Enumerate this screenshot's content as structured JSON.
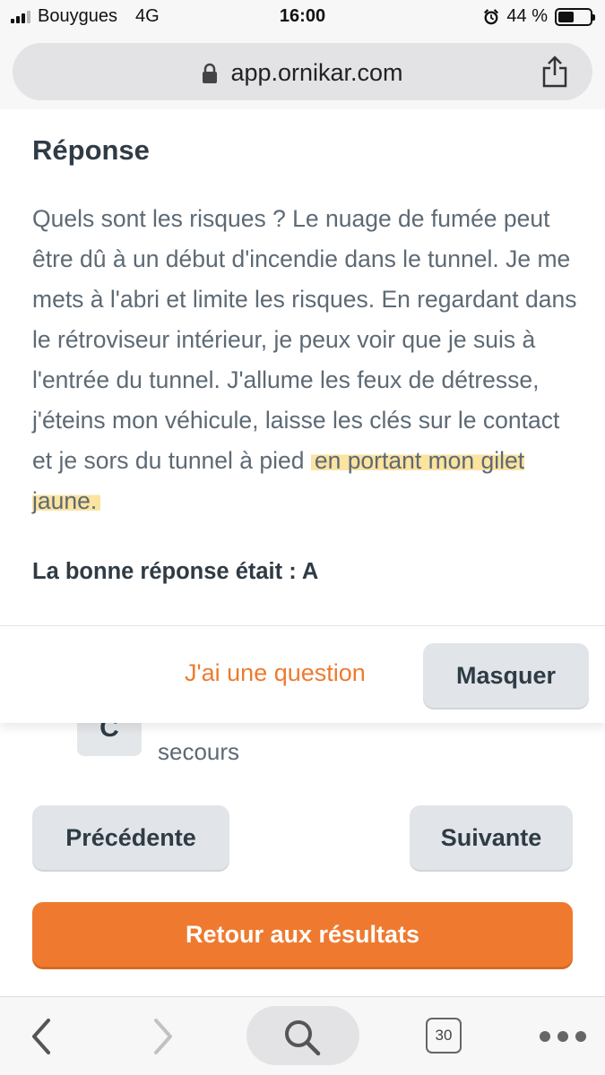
{
  "status_bar": {
    "carrier": "Bouygues",
    "network": "4G",
    "time": "16:00",
    "battery_percent": "44 %",
    "battery_level": 0.44
  },
  "browser": {
    "url": "app.ornikar.com",
    "tabs_count": "30"
  },
  "answer_panel": {
    "title": "Réponse",
    "explanation": "Quels sont les risques ? Le nuage de fumée peut être dû à un début d'incendie dans le tunnel. Je me mets à l'abri et limite les risques. En regardant dans le rétroviseur intérieur, je peux voir que je suis à l'entrée du tunnel. J'allume les feux de détresse, j'éteins mon véhicule, laisse les clés sur le contact et je sors du tunnel à pied ",
    "explanation_highlight": "en portant mon gilet jaune.",
    "correct_answer": "La bonne réponse était : A",
    "question_link": "J'ai une question",
    "hide_button": "Masquer"
  },
  "quiz": {
    "option_c_letter": "C",
    "option_c_text": "secours",
    "prev_button": "Précédente",
    "next_button": "Suivante",
    "results_button": "Retour aux résultats"
  },
  "colors": {
    "accent_orange": "#ef7a2f",
    "highlight_yellow": "#fbe3a0",
    "button_gray": "#e1e5e9",
    "text_dark": "#2f3b45"
  }
}
